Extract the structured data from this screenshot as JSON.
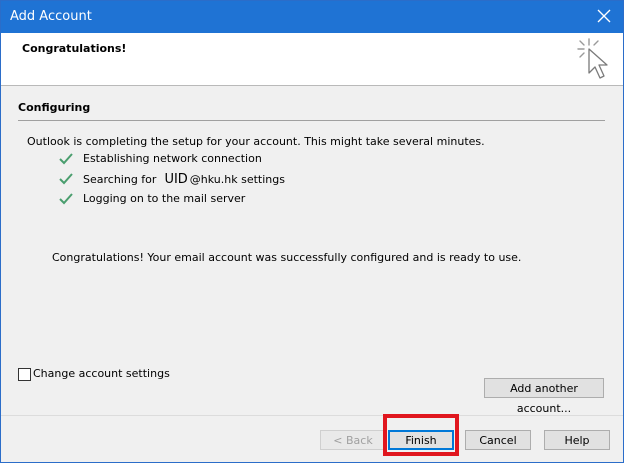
{
  "window": {
    "title": "Add Account",
    "close_icon": "close-icon"
  },
  "header": {
    "heading": "Congratulations!",
    "decoration_icon": "magic-wand-cursor-icon"
  },
  "section": {
    "title": "Configuring",
    "description": "Outlook is completing the setup for your account. This might take several minutes."
  },
  "steps": [
    {
      "label": "Establishing network connection",
      "status": "done"
    },
    {
      "label_prefix": "Searching for",
      "uid": "UID",
      "label_suffix": "@hku.hk settings",
      "status": "done"
    },
    {
      "label": "Logging on to the mail server",
      "status": "done"
    }
  ],
  "message": "Congratulations! Your email account was successfully configured and is ready to use.",
  "options": {
    "change_settings_label": "Change account settings",
    "change_settings_checked": false
  },
  "buttons": {
    "add_another": "Add another account...",
    "back": "< Back",
    "finish": "Finish",
    "cancel": "Cancel",
    "help": "Help"
  },
  "colors": {
    "titlebar": "#1f73d4",
    "check": "#4a9e6e",
    "highlight": "#e0161e"
  }
}
